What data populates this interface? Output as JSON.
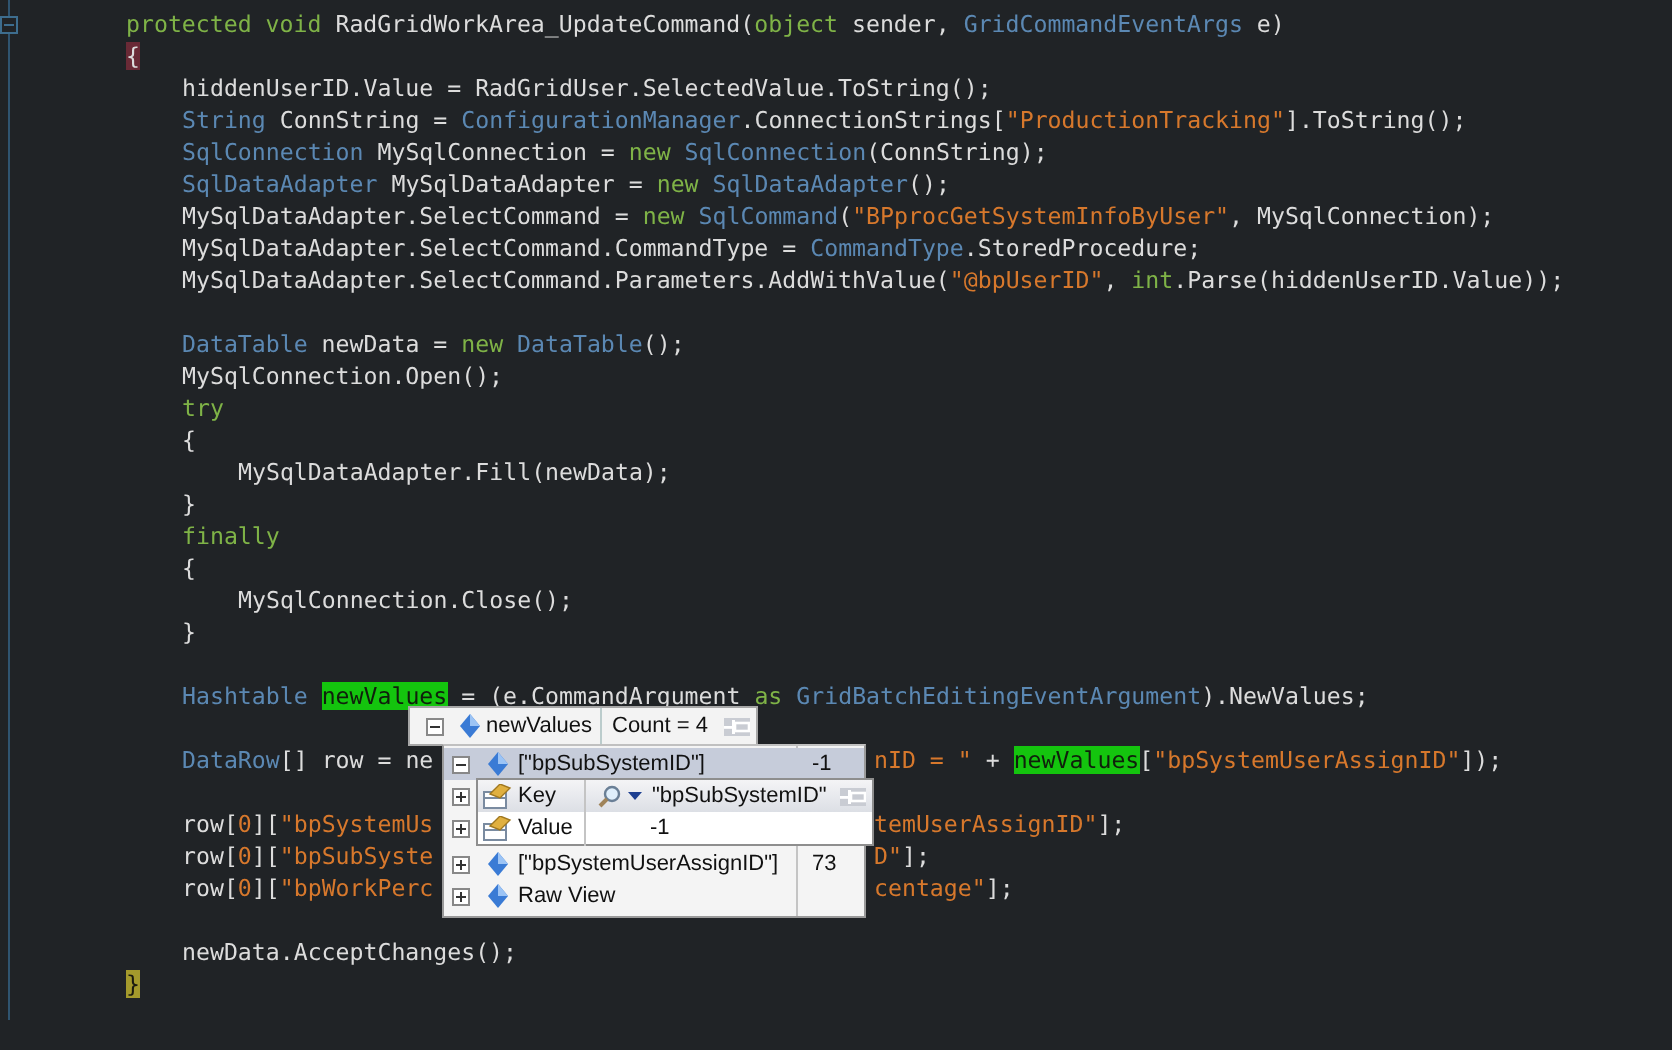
{
  "code": [
    {
      "kind": "code",
      "tokens": [
        {
          "kind": "kw",
          "t": "protected void"
        },
        {
          "kind": "plain",
          "t": " RadGridWorkArea_UpdateCommand("
        },
        {
          "kind": "kw",
          "t": "object"
        },
        {
          "kind": "plain",
          "t": " sender, "
        },
        {
          "kind": "type",
          "t": "GridCommandEventArgs"
        },
        {
          "kind": "plain",
          "t": " e)"
        }
      ]
    },
    {
      "kind": "code",
      "tokens": [
        {
          "kind": "brace_open",
          "t": "{"
        }
      ],
      "children": [
        {
          "kind": "code",
          "tokens": [
            {
              "kind": "plain",
              "t": "hiddenUserID.Value = RadGridUser.SelectedValue.ToString();"
            }
          ]
        },
        {
          "kind": "code",
          "tokens": [
            {
              "kind": "type",
              "t": "String"
            },
            {
              "kind": "plain",
              "t": " ConnString = "
            },
            {
              "kind": "type",
              "t": "ConfigurationManager"
            },
            {
              "kind": "plain",
              "t": ".ConnectionStrings["
            },
            {
              "kind": "str",
              "t": "\"ProductionTracking\""
            },
            {
              "kind": "plain",
              "t": "].ToString();"
            }
          ]
        },
        {
          "kind": "code",
          "tokens": [
            {
              "kind": "type",
              "t": "SqlConnection"
            },
            {
              "kind": "plain",
              "t": " MySqlConnection = "
            },
            {
              "kind": "kw",
              "t": "new"
            },
            {
              "kind": "type",
              "t": " SqlConnection"
            },
            {
              "kind": "plain",
              "t": "(ConnString);"
            }
          ]
        },
        {
          "kind": "code",
          "tokens": [
            {
              "kind": "type",
              "t": "SqlDataAdapter"
            },
            {
              "kind": "plain",
              "t": " MySqlDataAdapter = "
            },
            {
              "kind": "kw",
              "t": "new"
            },
            {
              "kind": "type",
              "t": " SqlDataAdapter"
            },
            {
              "kind": "plain",
              "t": "();"
            }
          ]
        },
        {
          "kind": "code",
          "tokens": [
            {
              "kind": "plain",
              "t": "MySqlDataAdapter.SelectCommand = "
            },
            {
              "kind": "kw",
              "t": "new"
            },
            {
              "kind": "type",
              "t": " SqlCommand"
            },
            {
              "kind": "plain",
              "t": "("
            },
            {
              "kind": "str",
              "t": "\"BPprocGetSystemInfoByUser\""
            },
            {
              "kind": "plain",
              "t": ", MySqlConnection);"
            }
          ]
        },
        {
          "kind": "code",
          "tokens": [
            {
              "kind": "plain",
              "t": "MySqlDataAdapter.SelectCommand.CommandType = "
            },
            {
              "kind": "type",
              "t": "CommandType"
            },
            {
              "kind": "plain",
              "t": ".StoredProcedure;"
            }
          ]
        },
        {
          "kind": "code",
          "tokens": [
            {
              "kind": "plain",
              "t": "MySqlDataAdapter.SelectCommand.Parameters.AddWithValue("
            },
            {
              "kind": "str",
              "t": "\"@bpUserID\""
            },
            {
              "kind": "plain",
              "t": ", "
            },
            {
              "kind": "kw",
              "t": "int"
            },
            {
              "kind": "plain",
              "t": ".Parse(hiddenUserID.Value));"
            }
          ]
        },
        {
          "kind": "blank"
        },
        {
          "kind": "code",
          "tokens": [
            {
              "kind": "type",
              "t": "DataTable"
            },
            {
              "kind": "plain",
              "t": " newData = "
            },
            {
              "kind": "kw",
              "t": "new"
            },
            {
              "kind": "type",
              "t": " DataTable"
            },
            {
              "kind": "plain",
              "t": "();"
            }
          ]
        },
        {
          "kind": "code",
          "tokens": [
            {
              "kind": "plain",
              "t": "MySqlConnection.Open();"
            }
          ]
        },
        {
          "kind": "code",
          "tokens": [
            {
              "kind": "kw",
              "t": "try"
            }
          ]
        },
        {
          "kind": "code",
          "tokens": [
            {
              "kind": "plain",
              "t": "{"
            }
          ],
          "children": [
            {
              "kind": "code",
              "tokens": [
                {
                  "kind": "plain",
                  "t": "MySqlDataAdapter.Fill(newData);"
                }
              ]
            }
          ]
        },
        {
          "kind": "code",
          "tokens": [
            {
              "kind": "plain",
              "t": "}"
            }
          ]
        },
        {
          "kind": "code",
          "tokens": [
            {
              "kind": "kw",
              "t": "finally"
            }
          ]
        },
        {
          "kind": "code",
          "tokens": [
            {
              "kind": "plain",
              "t": "{"
            }
          ],
          "children": [
            {
              "kind": "code",
              "tokens": [
                {
                  "kind": "plain",
                  "t": "MySqlConnection.Close();"
                }
              ]
            }
          ]
        },
        {
          "kind": "code",
          "tokens": [
            {
              "kind": "plain",
              "t": "}"
            }
          ]
        },
        {
          "kind": "blank"
        },
        {
          "kind": "code",
          "tokens": [
            {
              "kind": "type",
              "t": "Hashtable "
            },
            {
              "kind": "hl",
              "t": "newValues"
            },
            {
              "kind": "plain",
              "t": " = (e.CommandArgument "
            },
            {
              "kind": "kw",
              "t": "as"
            },
            {
              "kind": "type",
              "t": " GridBatchEditingEventArgument"
            },
            {
              "kind": "plain",
              "t": ").NewValues;"
            }
          ]
        },
        {
          "kind": "blank"
        },
        {
          "kind": "covered",
          "tokens": [
            {
              "kind": "type",
              "t": "DataRow"
            },
            {
              "kind": "plain",
              "t": "[] row = ne"
            }
          ],
          "after_tip": [
            {
              "kind": "str",
              "t": "nID = \""
            },
            {
              "kind": "plain",
              "t": " + "
            },
            {
              "kind": "hl",
              "t": "newValues"
            },
            {
              "kind": "plain",
              "t": "["
            },
            {
              "kind": "str",
              "t": "\"bpSystemUserAssignID\""
            },
            {
              "kind": "plain",
              "t": "]);"
            }
          ]
        },
        {
          "kind": "blank"
        },
        {
          "kind": "covered",
          "tokens": [
            {
              "kind": "plain",
              "t": "row["
            },
            {
              "kind": "str",
              "t": "0"
            },
            {
              "kind": "plain",
              "t": "]["
            },
            {
              "kind": "str",
              "t": "\"bpSystemUs"
            }
          ],
          "after_tip": [
            {
              "kind": "str",
              "t": "temUserAssignID\""
            },
            {
              "kind": "plain",
              "t": "];"
            }
          ]
        },
        {
          "kind": "covered",
          "tokens": [
            {
              "kind": "plain",
              "t": "row["
            },
            {
              "kind": "str",
              "t": "0"
            },
            {
              "kind": "plain",
              "t": "]["
            },
            {
              "kind": "str",
              "t": "\"bpSubSyste"
            }
          ],
          "after_tip": [
            {
              "kind": "str",
              "t": "D\""
            },
            {
              "kind": "plain",
              "t": "];"
            }
          ]
        },
        {
          "kind": "covered",
          "tokens": [
            {
              "kind": "plain",
              "t": "row["
            },
            {
              "kind": "str",
              "t": "0"
            },
            {
              "kind": "plain",
              "t": "]["
            },
            {
              "kind": "str",
              "t": "\"bpWorkPerc"
            }
          ],
          "after_tip": [
            {
              "kind": "str",
              "t": "centage\""
            },
            {
              "kind": "plain",
              "t": "];"
            }
          ]
        },
        {
          "kind": "blank"
        },
        {
          "kind": "code",
          "tokens": [
            {
              "kind": "plain",
              "t": "newData.AcceptChanges();"
            }
          ]
        }
      ]
    },
    {
      "kind": "code",
      "tokens": [
        {
          "kind": "brace_close",
          "t": "}"
        }
      ]
    }
  ],
  "datatip": {
    "name": "newValues",
    "value": "Count = 4",
    "expanded": true,
    "items": [
      {
        "name": "[\"bpSubSystemID\"]",
        "value": "-1",
        "expanded": true,
        "selected": true
      },
      {
        "expanded": false,
        "selected": false
      },
      {
        "expanded": false,
        "selected": false
      },
      {
        "name": "[\"bpSystemUserAssignID\"]",
        "value": "73",
        "expanded": false,
        "selected": false
      },
      {
        "name": "Raw View",
        "expanded": false,
        "selected": false
      }
    ],
    "subtip": {
      "rows": [
        {
          "kind": "key",
          "name": "Key",
          "value": "\"bpSubSystemID\""
        },
        {
          "kind": "value",
          "name": "Value",
          "value": "-1"
        }
      ]
    }
  }
}
